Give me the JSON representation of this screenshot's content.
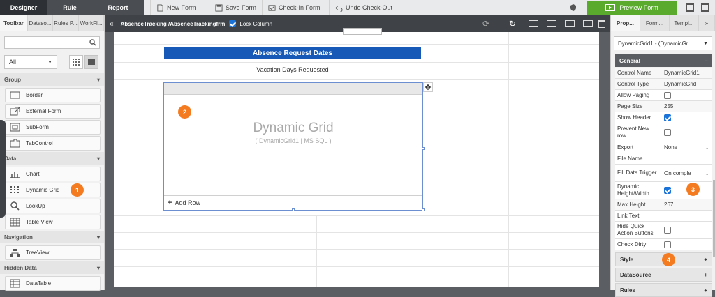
{
  "topbar": {
    "tabs": [
      "Designer",
      "Rule",
      "Report"
    ],
    "actions": [
      "New Form",
      "Save Form",
      "Check-In Form",
      "Undo Check-Out"
    ],
    "preview_label": "Preview Form"
  },
  "left": {
    "tabs": [
      "Toolbar",
      "Dataso...",
      "Rules P...",
      "WorkFl..."
    ],
    "filter_value": "All",
    "sections": {
      "group": "Group",
      "data": "Data",
      "navigation": "Navigation",
      "hidden_data": "Hidden Data"
    },
    "group_items": [
      "Border",
      "External Form",
      "SubForm",
      "TabControl"
    ],
    "data_items": [
      "Chart",
      "Dynamic Grid",
      "LookUp",
      "Table View"
    ],
    "nav_items": [
      "TreeView"
    ],
    "hidden_items": [
      "DataTable"
    ]
  },
  "canvas": {
    "breadcrumb": "AbsenceTracking /AbsenceTrackingfrm",
    "lock_label": "Lock Column",
    "header_title": "Absence Request Dates",
    "vacation_label": "Vacation Days Requested",
    "grid_title": "Dynamic Grid",
    "grid_subtitle": "( DynamicGrid1 | MS SQL )",
    "add_row": "Add Row"
  },
  "right": {
    "tabs": [
      "Prop...",
      "Form...",
      "Templ..."
    ],
    "selector": "DynamicGrid1 - (DynamicGr",
    "general": "General",
    "props": [
      {
        "k": "Control Name",
        "v": "DynamicGrid1"
      },
      {
        "k": "Control Type",
        "v": "DynamicGrid"
      },
      {
        "k": "Allow Paging",
        "v": ""
      },
      {
        "k": "Page Size",
        "v": "255"
      },
      {
        "k": "Show Header",
        "v": ""
      },
      {
        "k": "Prevent New row",
        "v": ""
      },
      {
        "k": "Export",
        "v": "None"
      },
      {
        "k": "File Name",
        "v": ""
      },
      {
        "k": "Fill Data Trigger",
        "v": "On comple"
      },
      {
        "k": "Dynamic Height/Width",
        "v": ""
      },
      {
        "k": "Max Height",
        "v": "267"
      },
      {
        "k": "Link Text",
        "v": ""
      },
      {
        "k": "Hide Quick Action Buttons",
        "v": ""
      },
      {
        "k": "Check Dirty",
        "v": ""
      }
    ],
    "sections": [
      "Style",
      "DataSource",
      "Rules"
    ]
  },
  "badges": [
    "1",
    "2",
    "3",
    "4"
  ],
  "colors": {
    "accent": "#f47b20",
    "header_blue": "#1659b7",
    "preview_green": "#5aaa2e"
  }
}
